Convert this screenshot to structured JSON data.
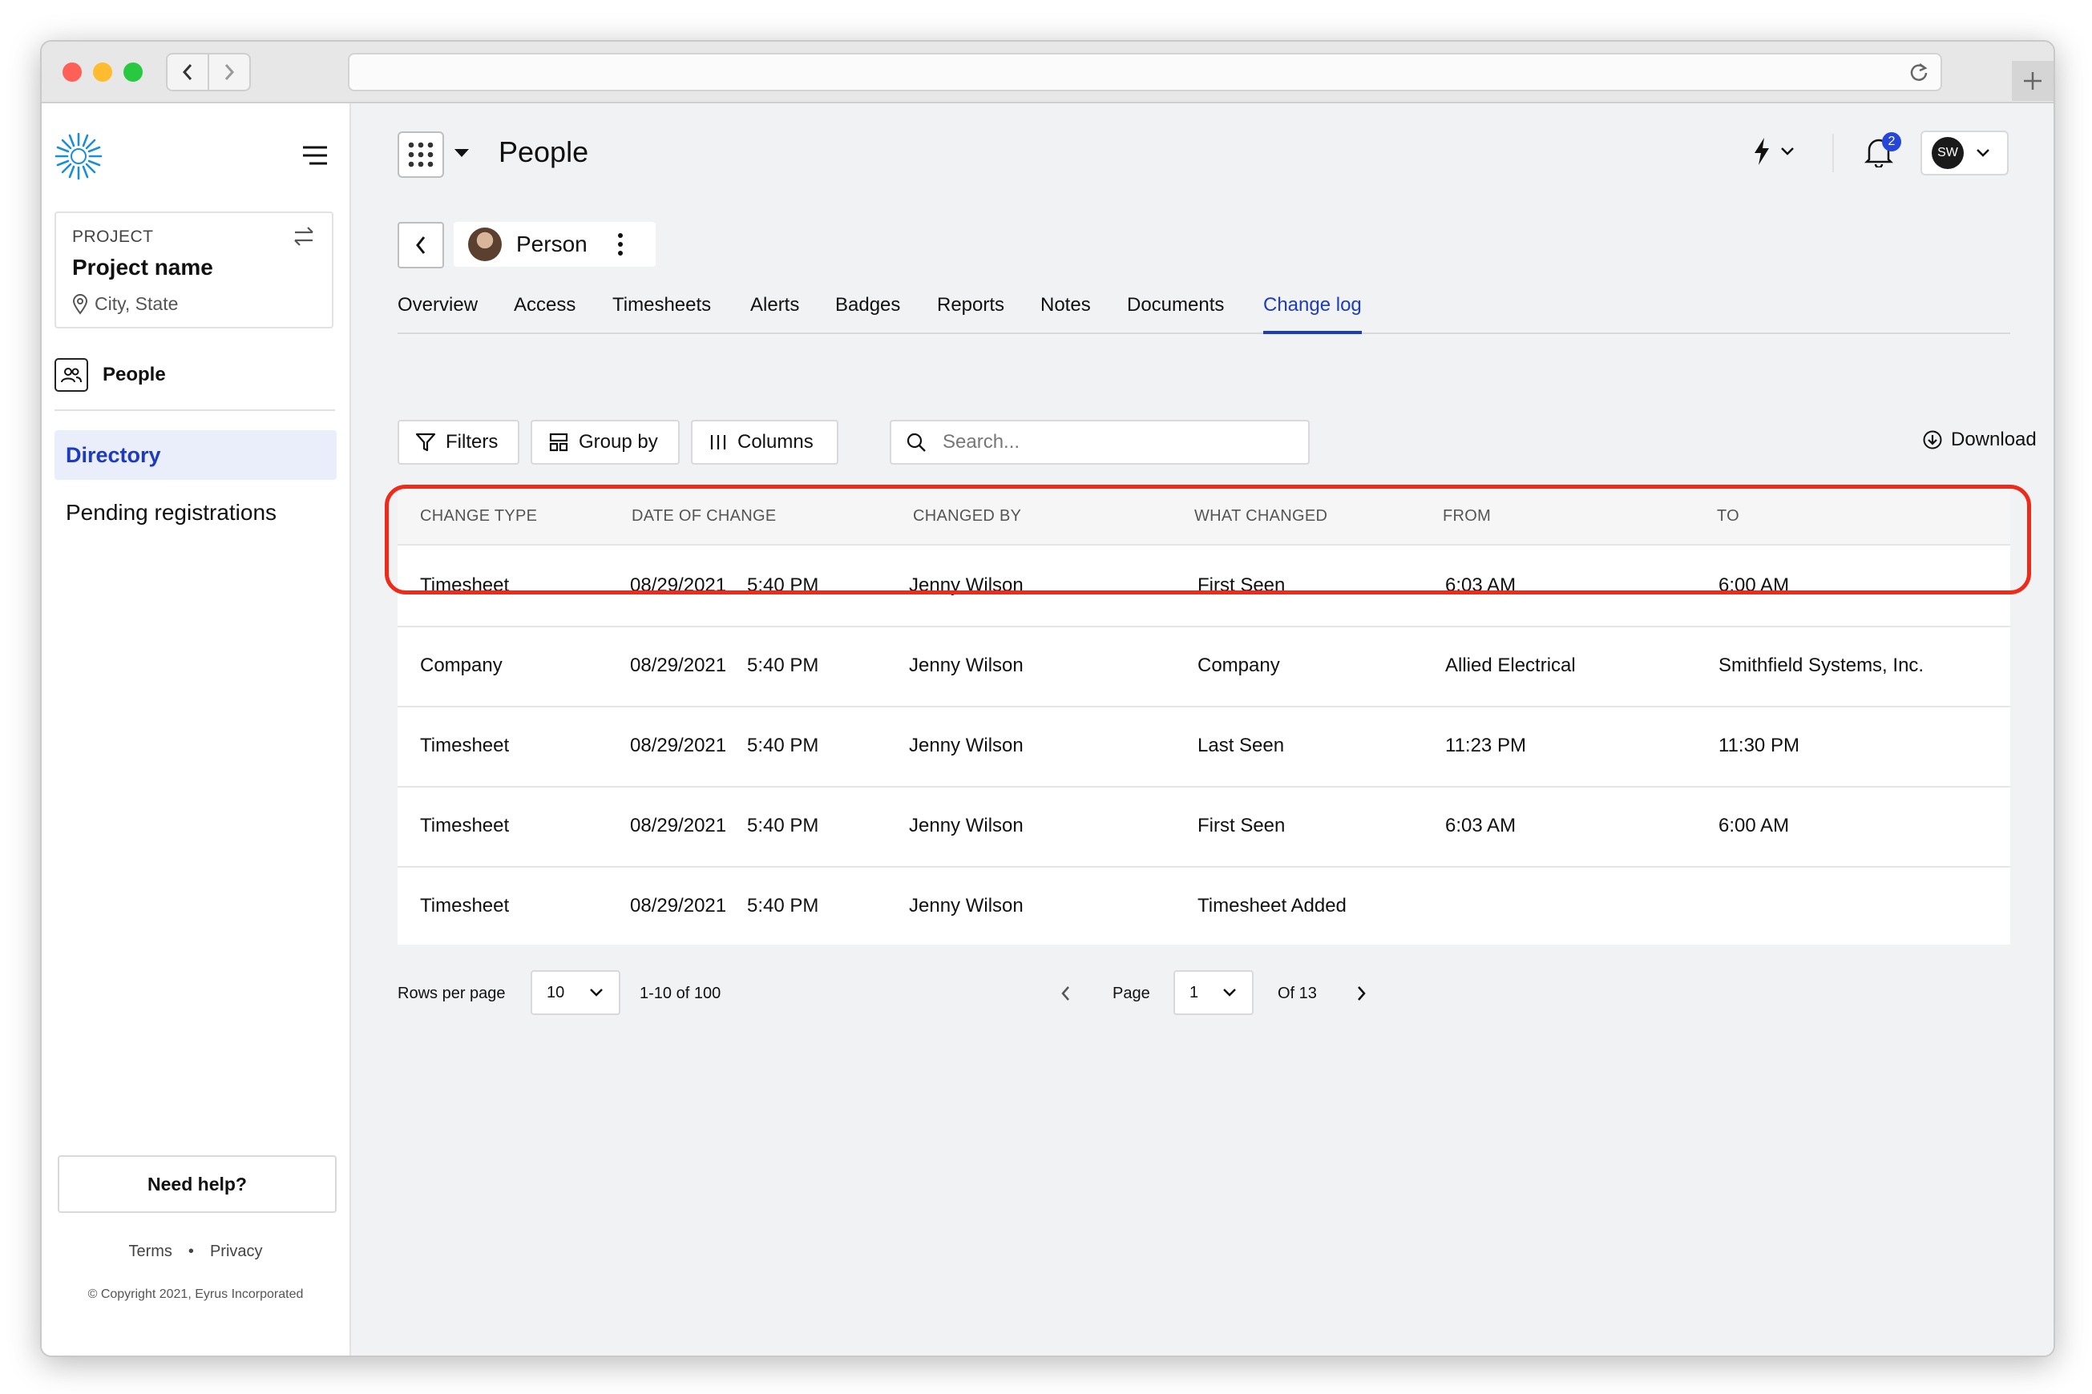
{
  "page": {
    "title": "People"
  },
  "sidebar": {
    "project": {
      "label": "PROJECT",
      "name": "Project name",
      "location": "City, State"
    },
    "section_label": "People",
    "items": [
      {
        "label": "Directory",
        "active": true
      },
      {
        "label": "Pending registrations",
        "active": false
      }
    ],
    "help_label": "Need help?",
    "terms": "Terms",
    "separator": "•",
    "privacy": "Privacy",
    "copyright": "© Copyright 2021, Eyrus Incorporated"
  },
  "header": {
    "notification_count": "2",
    "user_initials": "SW"
  },
  "person": {
    "name": "Person"
  },
  "tabs": [
    {
      "label": "Overview",
      "active": false
    },
    {
      "label": "Access",
      "active": false
    },
    {
      "label": "Timesheets",
      "active": false
    },
    {
      "label": "Alerts",
      "active": false
    },
    {
      "label": "Badges",
      "active": false
    },
    {
      "label": "Reports",
      "active": false
    },
    {
      "label": "Notes",
      "active": false
    },
    {
      "label": "Documents",
      "active": false
    },
    {
      "label": "Change log",
      "active": true
    }
  ],
  "toolbar": {
    "filters": "Filters",
    "group_by": "Group by",
    "columns": "Columns",
    "search_placeholder": "Search...",
    "download": "Download"
  },
  "table": {
    "columns": [
      "CHANGE TYPE",
      "DATE OF CHANGE",
      "CHANGED BY",
      "WHAT CHANGED",
      "FROM",
      "TO"
    ],
    "rows": [
      {
        "type": "Timesheet",
        "date": "08/29/2021",
        "time": "5:40 PM",
        "by": "Jenny Wilson",
        "what": "First Seen",
        "from": "6:03 AM",
        "to": "6:00 AM",
        "highlighted": true
      },
      {
        "type": "Company",
        "date": "08/29/2021",
        "time": "5:40 PM",
        "by": "Jenny Wilson",
        "what": "Company",
        "from": "Allied Electrical",
        "to": "Smithfield Systems, Inc."
      },
      {
        "type": "Timesheet",
        "date": "08/29/2021",
        "time": "5:40 PM",
        "by": "Jenny Wilson",
        "what": "Last Seen",
        "from": "11:23 PM",
        "to": "11:30 PM"
      },
      {
        "type": "Timesheet",
        "date": "08/29/2021",
        "time": "5:40 PM",
        "by": "Jenny Wilson",
        "what": "First Seen",
        "from": "6:03 AM",
        "to": "6:00 AM"
      },
      {
        "type": "Timesheet",
        "date": "08/29/2021",
        "time": "5:40 PM",
        "by": "Jenny Wilson",
        "what": "Timesheet Added",
        "from": "",
        "to": ""
      }
    ]
  },
  "pagination": {
    "rows_per_page_label": "Rows per page",
    "rows_per_page": "10",
    "range": "1-10 of 100",
    "page_label": "Page",
    "page": "1",
    "of_label": "Of 13"
  },
  "colors": {
    "accent": "#1d3bbd",
    "highlight_border": "#ee2b1a",
    "badge": "#2546d8",
    "logo": "#1b8fd6"
  }
}
